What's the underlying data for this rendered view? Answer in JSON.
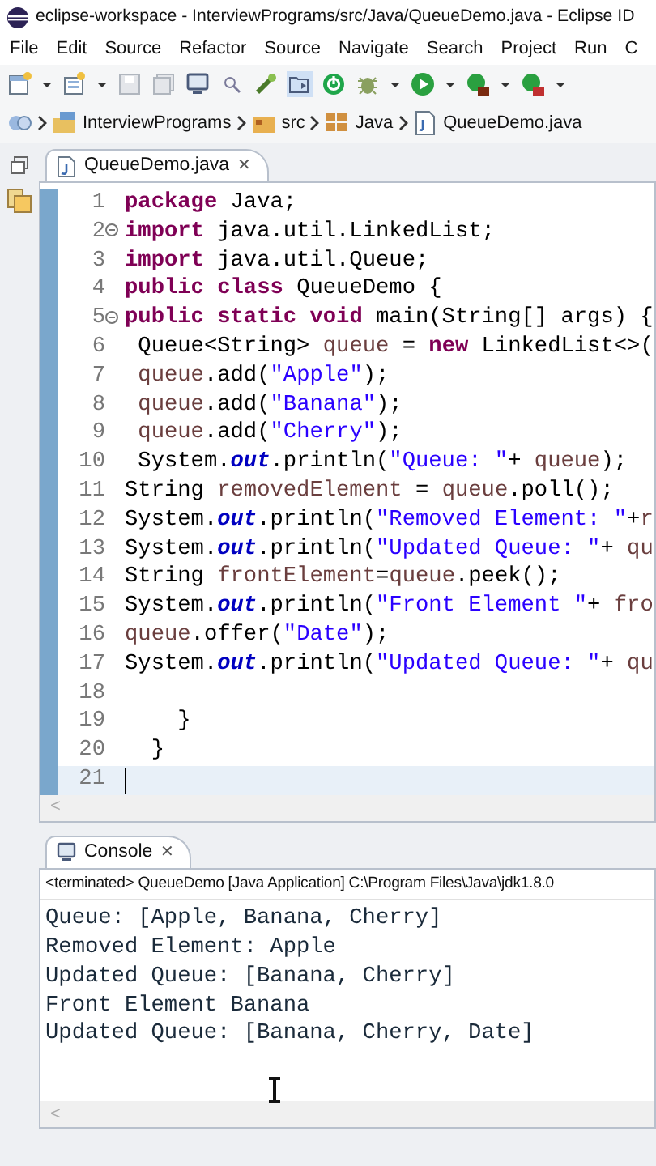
{
  "window": {
    "title": "eclipse-workspace - InterviewPrograms/src/Java/QueueDemo.java - Eclipse ID"
  },
  "menu": [
    "File",
    "Edit",
    "Source",
    "Refactor",
    "Source",
    "Navigate",
    "Search",
    "Project",
    "Run",
    "C"
  ],
  "breadcrumb": [
    {
      "label": "InterviewPrograms",
      "kind": "project"
    },
    {
      "label": "src",
      "kind": "folder"
    },
    {
      "label": "Java",
      "kind": "package"
    },
    {
      "label": "QueueDemo.java",
      "kind": "file"
    }
  ],
  "editor_tab": {
    "label": "QueueDemo.java",
    "close": "✕"
  },
  "code": [
    {
      "number": "1",
      "fold_marker": false,
      "current": false,
      "tokens": [
        {
          "kind": "keyword",
          "text": "package"
        },
        {
          "kind": "plain",
          "text": " Java;"
        }
      ]
    },
    {
      "number": "2",
      "fold_marker": true,
      "current": false,
      "tokens": [
        {
          "kind": "keyword",
          "text": "import"
        },
        {
          "kind": "plain",
          "text": " java.util.LinkedList;"
        }
      ]
    },
    {
      "number": "3",
      "fold_marker": false,
      "current": false,
      "tokens": [
        {
          "kind": "keyword",
          "text": "import"
        },
        {
          "kind": "plain",
          "text": " java.util.Queue;"
        }
      ]
    },
    {
      "number": "4",
      "fold_marker": false,
      "current": false,
      "tokens": [
        {
          "kind": "keyword",
          "text": "public"
        },
        {
          "kind": "keyword",
          "text": " class"
        },
        {
          "kind": "plain",
          "text": " QueueDemo {"
        }
      ]
    },
    {
      "number": "5",
      "fold_marker": true,
      "current": false,
      "tokens": [
        {
          "kind": "keyword",
          "text": "public"
        },
        {
          "kind": "keyword",
          "text": " static"
        },
        {
          "kind": "keyword",
          "text": " void"
        },
        {
          "kind": "plain",
          "text": " main(String[] args) {"
        }
      ]
    },
    {
      "number": "6",
      "fold_marker": false,
      "current": false,
      "tokens": [
        {
          "kind": "plain",
          "text": " Queue<String> "
        },
        {
          "kind": "variable",
          "text": "queue"
        },
        {
          "kind": "plain",
          "text": " = "
        },
        {
          "kind": "keyword",
          "text": "new"
        },
        {
          "kind": "plain",
          "text": " LinkedList<>("
        }
      ]
    },
    {
      "number": "7",
      "fold_marker": false,
      "current": false,
      "tokens": [
        {
          "kind": "variable",
          "text": " queue"
        },
        {
          "kind": "plain",
          "text": ".add("
        },
        {
          "kind": "string",
          "text": "\"Apple\""
        },
        {
          "kind": "plain",
          "text": ");"
        }
      ]
    },
    {
      "number": "8",
      "fold_marker": false,
      "current": false,
      "tokens": [
        {
          "kind": "variable",
          "text": " queue"
        },
        {
          "kind": "plain",
          "text": ".add("
        },
        {
          "kind": "string",
          "text": "\"Banana\""
        },
        {
          "kind": "plain",
          "text": ");"
        }
      ]
    },
    {
      "number": "9",
      "fold_marker": false,
      "current": false,
      "tokens": [
        {
          "kind": "variable",
          "text": " queue"
        },
        {
          "kind": "plain",
          "text": ".add("
        },
        {
          "kind": "string",
          "text": "\"Cherry\""
        },
        {
          "kind": "plain",
          "text": ");"
        }
      ]
    },
    {
      "number": "10",
      "fold_marker": false,
      "current": false,
      "tokens": [
        {
          "kind": "plain",
          "text": " System."
        },
        {
          "kind": "field",
          "text": "out"
        },
        {
          "kind": "plain",
          "text": ".println("
        },
        {
          "kind": "string",
          "text": "\"Queue: \""
        },
        {
          "kind": "plain",
          "text": "+ "
        },
        {
          "kind": "variable",
          "text": "queue"
        },
        {
          "kind": "plain",
          "text": ");"
        }
      ]
    },
    {
      "number": "11",
      "fold_marker": false,
      "current": false,
      "tokens": [
        {
          "kind": "plain",
          "text": "String "
        },
        {
          "kind": "variable",
          "text": "removedElement"
        },
        {
          "kind": "plain",
          "text": " = "
        },
        {
          "kind": "variable",
          "text": "queue"
        },
        {
          "kind": "plain",
          "text": ".poll();"
        }
      ]
    },
    {
      "number": "12",
      "fold_marker": false,
      "current": false,
      "tokens": [
        {
          "kind": "plain",
          "text": "System."
        },
        {
          "kind": "field",
          "text": "out"
        },
        {
          "kind": "plain",
          "text": ".println("
        },
        {
          "kind": "string",
          "text": "\"Removed Element: \""
        },
        {
          "kind": "plain",
          "text": "+"
        },
        {
          "kind": "variable",
          "text": "r"
        }
      ]
    },
    {
      "number": "13",
      "fold_marker": false,
      "current": false,
      "tokens": [
        {
          "kind": "plain",
          "text": "System."
        },
        {
          "kind": "field",
          "text": "out"
        },
        {
          "kind": "plain",
          "text": ".println("
        },
        {
          "kind": "string",
          "text": "\"Updated Queue: \""
        },
        {
          "kind": "plain",
          "text": "+ "
        },
        {
          "kind": "variable",
          "text": "qu"
        }
      ]
    },
    {
      "number": "14",
      "fold_marker": false,
      "current": false,
      "tokens": [
        {
          "kind": "plain",
          "text": "String "
        },
        {
          "kind": "variable",
          "text": "frontElement"
        },
        {
          "kind": "plain",
          "text": "="
        },
        {
          "kind": "variable",
          "text": "queue"
        },
        {
          "kind": "plain",
          "text": ".peek();"
        }
      ]
    },
    {
      "number": "15",
      "fold_marker": false,
      "current": false,
      "tokens": [
        {
          "kind": "plain",
          "text": "System."
        },
        {
          "kind": "field",
          "text": "out"
        },
        {
          "kind": "plain",
          "text": ".println("
        },
        {
          "kind": "string",
          "text": "\"Front Element \""
        },
        {
          "kind": "plain",
          "text": "+ "
        },
        {
          "kind": "variable",
          "text": "fro"
        }
      ]
    },
    {
      "number": "16",
      "fold_marker": false,
      "current": false,
      "tokens": [
        {
          "kind": "variable",
          "text": "queue"
        },
        {
          "kind": "plain",
          "text": ".offer("
        },
        {
          "kind": "string",
          "text": "\"Date\""
        },
        {
          "kind": "plain",
          "text": ");"
        }
      ]
    },
    {
      "number": "17",
      "fold_marker": false,
      "current": false,
      "tokens": [
        {
          "kind": "plain",
          "text": "System."
        },
        {
          "kind": "field",
          "text": "out"
        },
        {
          "kind": "plain",
          "text": ".println("
        },
        {
          "kind": "string",
          "text": "\"Updated Queue: \""
        },
        {
          "kind": "plain",
          "text": "+ "
        },
        {
          "kind": "variable",
          "text": "qu"
        }
      ]
    },
    {
      "number": "18",
      "fold_marker": false,
      "current": false
    },
    {
      "number": "19",
      "fold_marker": false,
      "current": false,
      "tokens": [
        {
          "kind": "plain",
          "text": "    }"
        }
      ]
    },
    {
      "number": "20",
      "fold_marker": false,
      "current": false,
      "tokens": [
        {
          "kind": "plain",
          "text": "  }"
        }
      ]
    },
    {
      "number": "21",
      "fold_marker": false,
      "current": true
    }
  ],
  "console": {
    "tab_label": "Console",
    "close": "✕",
    "status": "<terminated> QueueDemo [Java Application] C:\\Program Files\\Java\\jdk1.8.0",
    "output": [
      "Queue: [Apple, Banana, Cherry]",
      "Removed Element: Apple",
      "Updated Queue: [Banana, Cherry]",
      "Front Element Banana",
      "Updated Queue: [Banana, Cherry, Date]"
    ]
  },
  "scroll_arrow": "<"
}
